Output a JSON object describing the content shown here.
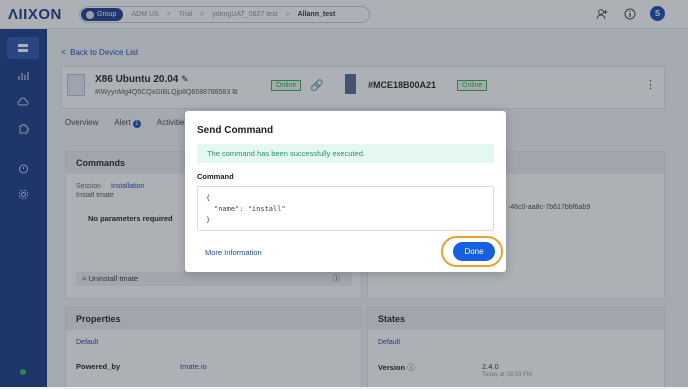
{
  "header": {
    "logo": "ΛIIXON",
    "breadcrumb": [
      "Group",
      "ADM US",
      "Trial",
      "ydengUAT_0627 test",
      "Allann_test"
    ],
    "avatar_initial": "S"
  },
  "back_link": "Back to Device List",
  "device": {
    "name": "X86 Ubuntu 20.04",
    "id": "#IWyynMg4Q5CQxGIBLQjp8Q6588788583",
    "status": "Online",
    "linked_name": "#MCE18B00A21",
    "linked_status": "Online"
  },
  "tabs": [
    "Overview",
    "Alert",
    "Activities"
  ],
  "alert_count": "1",
  "commands_panel": {
    "title": "Commands",
    "subtabs": [
      "Session",
      "Installation"
    ],
    "section1": "Install tmate",
    "no_params": "No parameters required",
    "section2": "Uninstall tmate"
  },
  "right_panel_fragment": "-46c0-aa8c-7b617bbf6ab9",
  "properties": {
    "title": "Properties",
    "subtitle": "Default",
    "row_label": "Powered_by",
    "row_value": "tmate.io"
  },
  "states": {
    "title": "States",
    "subtitle": "Default",
    "row_label": "Version",
    "row_value": "2.4.0",
    "row_time": "Today at 03:03 PM"
  },
  "modal": {
    "title": "Send Command",
    "alert": "The command has been successfully executed.",
    "command_label": "Command",
    "command_lines": [
      "{",
      "\"name\": \"install\"",
      "}"
    ],
    "more_info": "More Information",
    "done": "Done"
  },
  "colors": {
    "brand": "#193a86",
    "accent": "#1560e0",
    "highlight": "#f0a02a",
    "success": "#33b14e"
  }
}
